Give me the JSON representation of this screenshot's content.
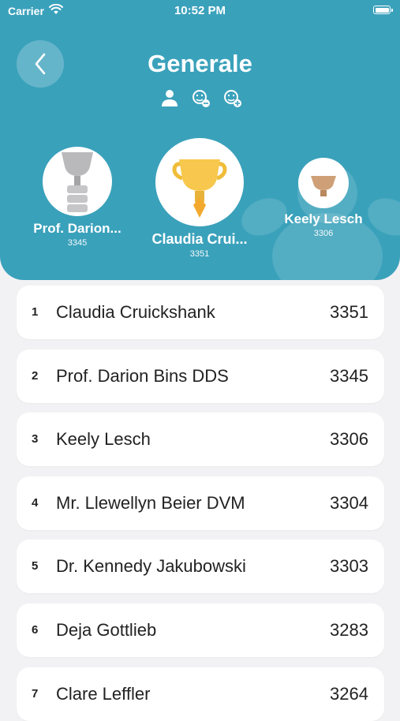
{
  "status_bar": {
    "carrier": "Carrier",
    "time": "10:52 PM"
  },
  "header": {
    "title": "Generale",
    "filters": [
      "person-icon",
      "group-minus-icon",
      "group-plus-icon"
    ],
    "accent_color": "#3aa1bb"
  },
  "podium": {
    "first": {
      "name": "Claudia Crui...",
      "score": "3351"
    },
    "second": {
      "name": "Prof. Darion...",
      "score": "3345"
    },
    "third": {
      "name": "Keely Lesch",
      "score": "3306"
    }
  },
  "leaderboard": [
    {
      "rank": "1",
      "name": "Claudia Cruickshank",
      "score": "3351"
    },
    {
      "rank": "2",
      "name": "Prof. Darion Bins DDS",
      "score": "3345"
    },
    {
      "rank": "3",
      "name": "Keely Lesch",
      "score": "3306"
    },
    {
      "rank": "4",
      "name": "Mr. Llewellyn Beier DVM",
      "score": "3304"
    },
    {
      "rank": "5",
      "name": "Dr. Kennedy Jakubowski",
      "score": "3303"
    },
    {
      "rank": "6",
      "name": "Deja Gottlieb",
      "score": "3283"
    },
    {
      "rank": "7",
      "name": "Clare Leffler",
      "score": "3264"
    }
  ]
}
